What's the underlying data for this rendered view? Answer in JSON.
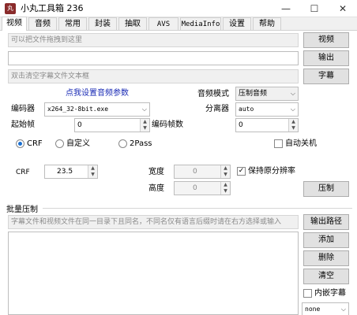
{
  "window": {
    "icon_glyph": "丸",
    "title": "小丸工具箱 236",
    "minimize_glyph": "—",
    "maximize_glyph": "☐",
    "close_glyph": "✕"
  },
  "tabs": [
    {
      "label": "视频"
    },
    {
      "label": "音频"
    },
    {
      "label": "常用"
    },
    {
      "label": "封装"
    },
    {
      "label": "抽取"
    },
    {
      "label": "AVS"
    },
    {
      "label": "MediaInfo"
    },
    {
      "label": "设置"
    },
    {
      "label": "帮助"
    }
  ],
  "video": {
    "video_input_placeholder": "可以把文件拖拽到这里",
    "video_button": "视频",
    "output_value": "",
    "output_button": "输出",
    "subtitle_placeholder": "双击清空字幕文件文本框",
    "subtitle_button": "字幕",
    "audio_settings_link": "点我设置音频参数",
    "audio_mode_label": "音频模式",
    "audio_mode_value": "压制音频",
    "encoder_label": "编码器",
    "encoder_value": "x264_32-8bit.exe",
    "demuxer_label": "分离器",
    "demuxer_value": "auto",
    "start_frame_label": "起始帧",
    "start_frame_value": "0",
    "encode_frames_label": "编码帧数",
    "encode_frames_value": "0",
    "rc_modes": [
      {
        "label": "CRF",
        "selected": true
      },
      {
        "label": "自定义",
        "selected": false
      },
      {
        "label": "2Pass",
        "selected": false
      }
    ],
    "auto_shutdown_label": "自动关机",
    "auto_shutdown_checked": false,
    "crf_label": "CRF",
    "crf_value": "23.5",
    "width_label": "宽度",
    "width_value": "0",
    "height_label": "高度",
    "height_value": "0",
    "keep_resolution_label": "保持原分辨率",
    "keep_resolution_checked": true,
    "encode_button": "压制"
  },
  "batch": {
    "group_title": "批量压制",
    "hint_text": "字幕文件和视频文件在同一目录下且同名，不同名仅有语言后缀时请在右方选择或输入",
    "subtitle_lang_value": "",
    "output_path_button": "输出路径",
    "add_button": "添加",
    "delete_button": "删除",
    "clear_button": "清空",
    "embed_subtitle_label": "内嵌字幕",
    "embed_subtitle_checked": false,
    "embed_mode_value": "none"
  },
  "colors": {
    "link_blue": "#1a2bb5",
    "radio_accent": "#1a6fd1"
  }
}
